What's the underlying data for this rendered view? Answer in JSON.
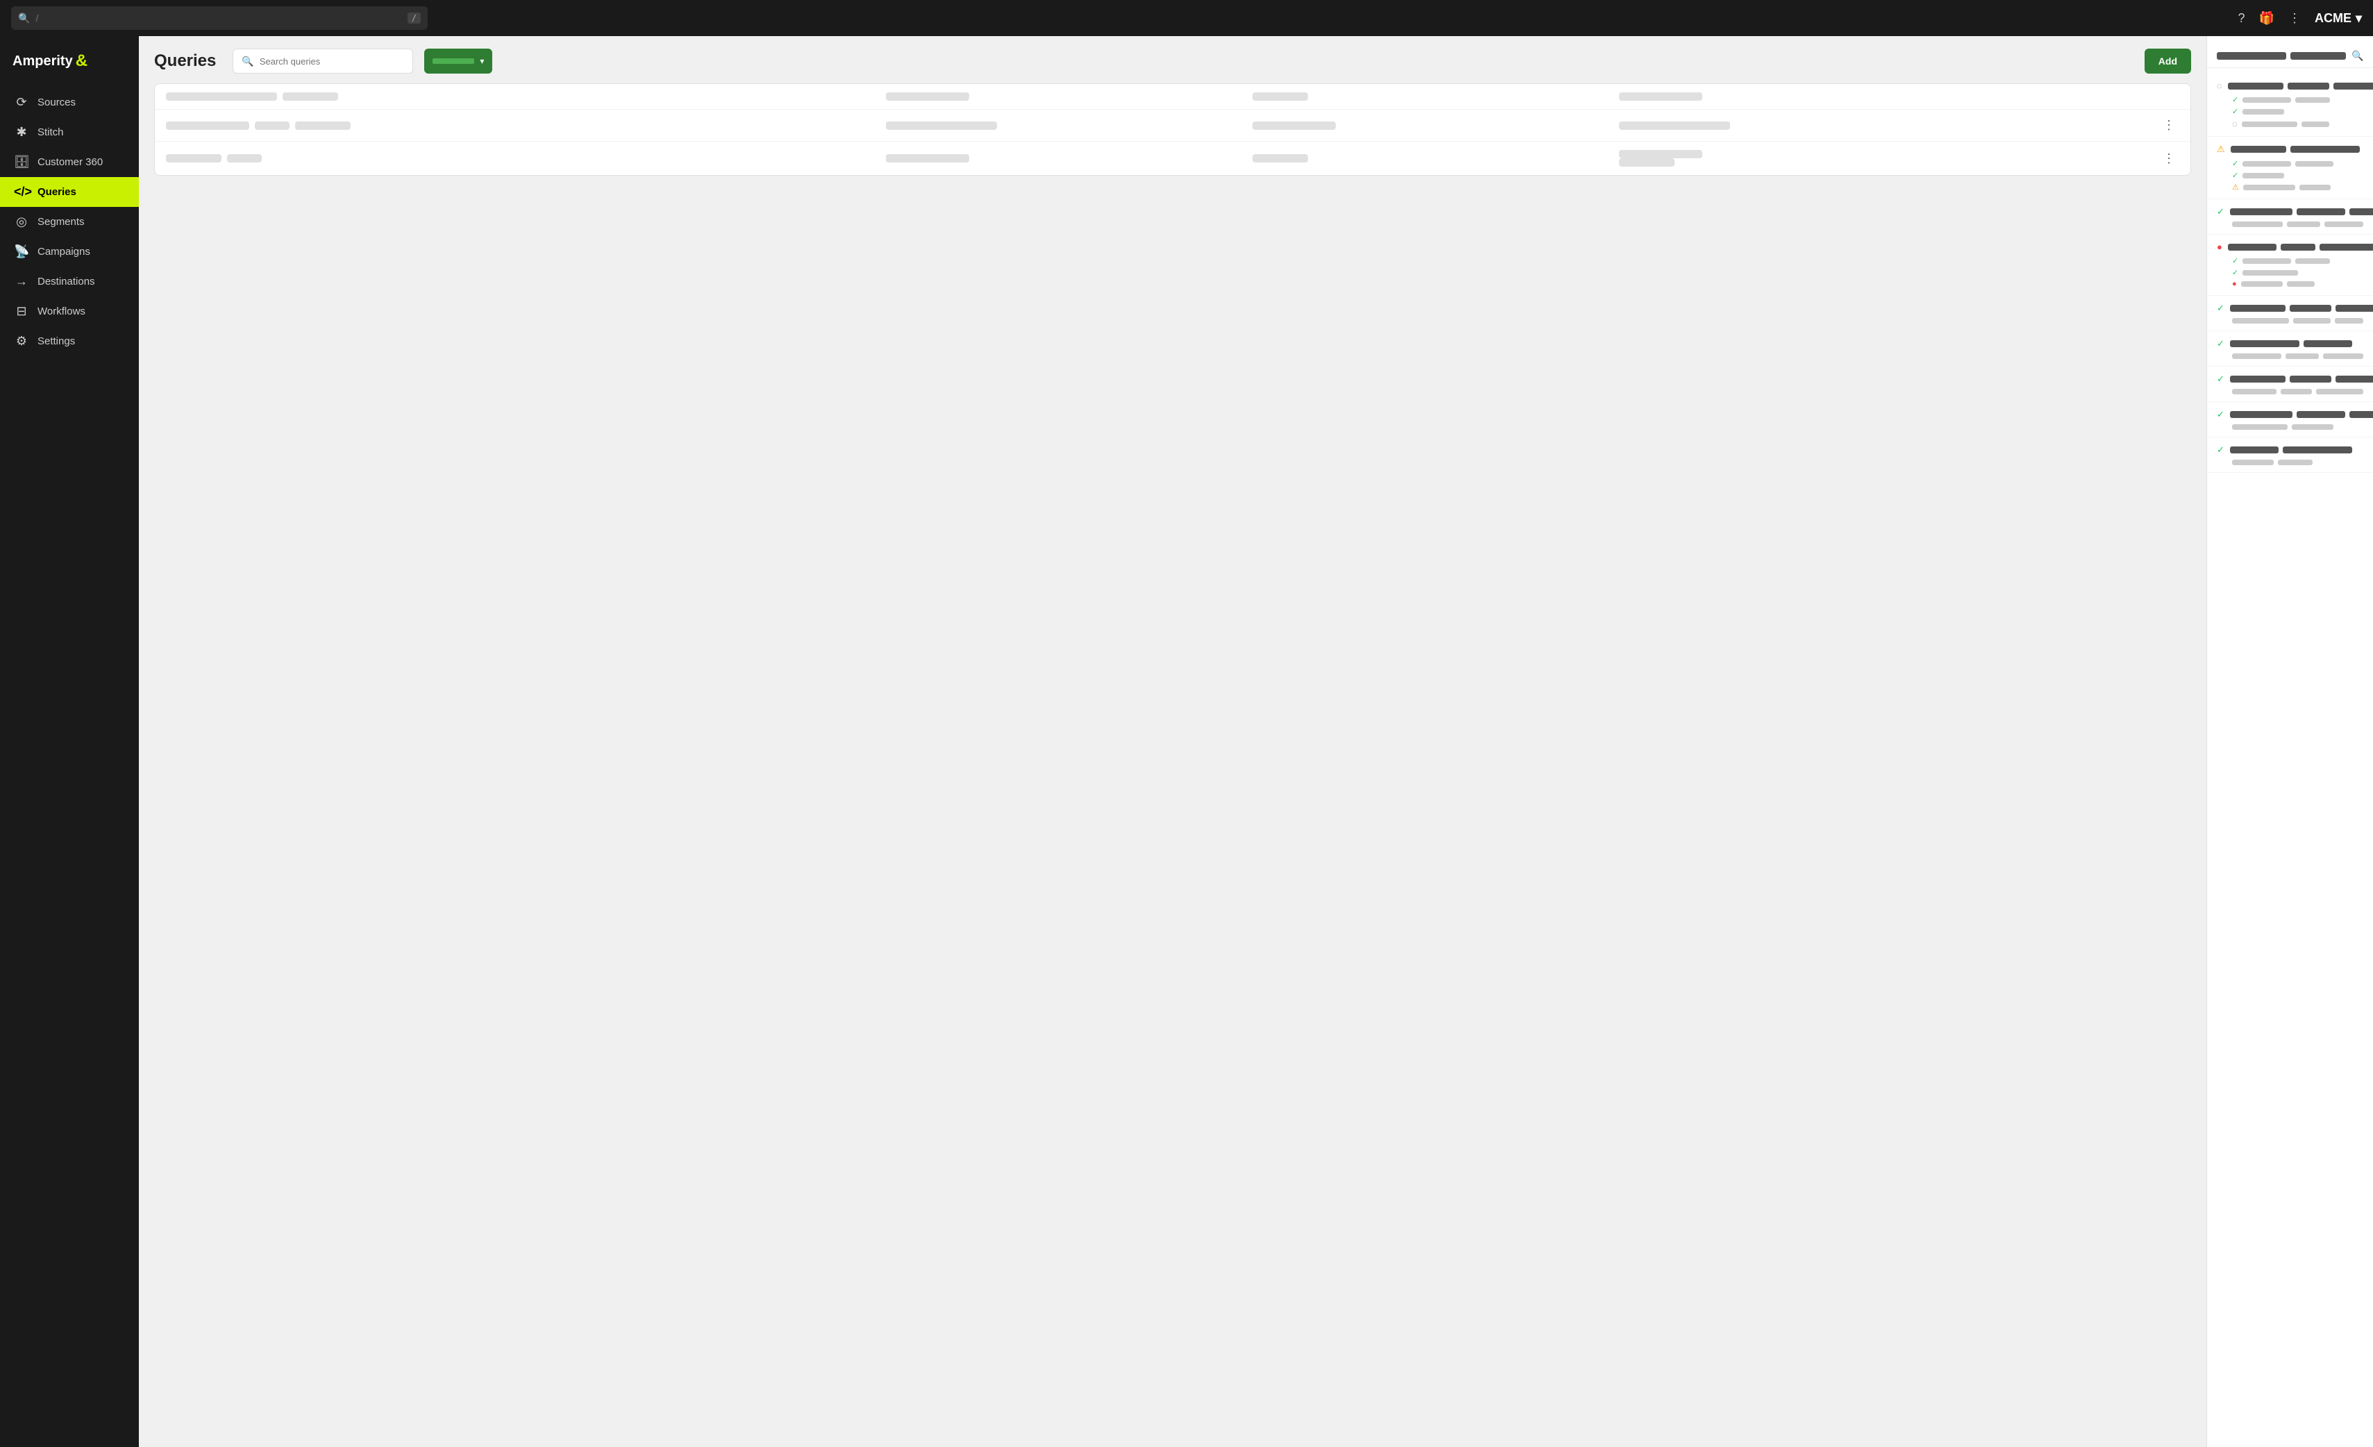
{
  "topbar": {
    "search_placeholder": "/",
    "account_name": "ACME",
    "help_icon": "?",
    "gift_icon": "🎁",
    "more_icon": "⋮",
    "chevron": "▾"
  },
  "sidebar": {
    "logo_text": "Amperity",
    "logo_symbol": "&",
    "nav_items": [
      {
        "id": "sources",
        "label": "Sources",
        "icon": "⟳"
      },
      {
        "id": "stitch",
        "label": "Stitch",
        "icon": "✱"
      },
      {
        "id": "customer360",
        "label": "Customer 360",
        "icon": "🗄"
      },
      {
        "id": "queries",
        "label": "Queries",
        "icon": "</>"
      },
      {
        "id": "segments",
        "label": "Segments",
        "icon": "◎"
      },
      {
        "id": "campaigns",
        "label": "Campaigns",
        "icon": "📡"
      },
      {
        "id": "destinations",
        "label": "Destinations",
        "icon": "→"
      },
      {
        "id": "workflows",
        "label": "Workflows",
        "icon": "⊟"
      },
      {
        "id": "settings",
        "label": "Settings",
        "icon": "⚙"
      }
    ]
  },
  "main": {
    "title": "Queries",
    "search_placeholder": "Search queries",
    "add_button": "Add"
  },
  "right_panel": {
    "search_icon": "🔍"
  }
}
